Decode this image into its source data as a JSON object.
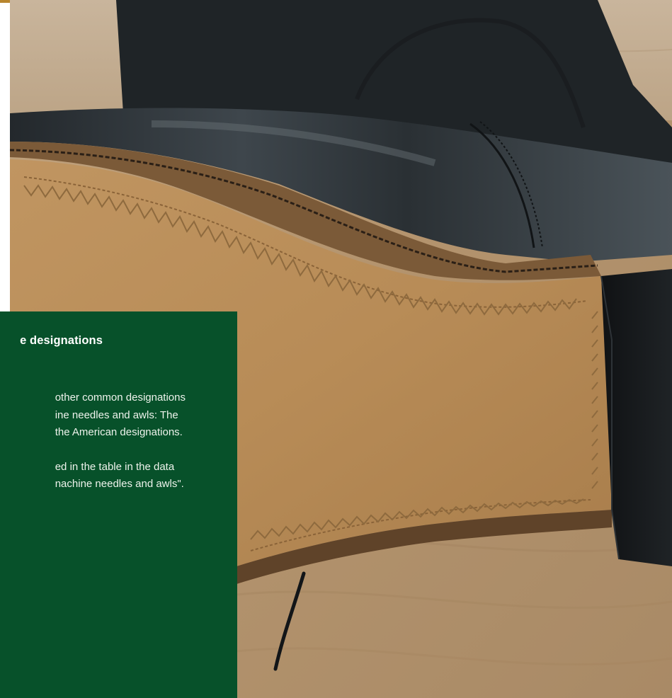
{
  "info_panel": {
    "title": "e designations",
    "paragraphs": [
      {
        "lines": [
          "other common designations",
          "ine needles and awls: The",
          "the American designations."
        ]
      },
      {
        "lines": [
          "ed in the table in the data",
          "nachine needles and awls\"."
        ]
      }
    ]
  },
  "colors": {
    "panel_green": "#07512a",
    "leather_tan": "#b98f5e",
    "boot_black": "#1d2124",
    "floor_wood": "#b99a76"
  }
}
